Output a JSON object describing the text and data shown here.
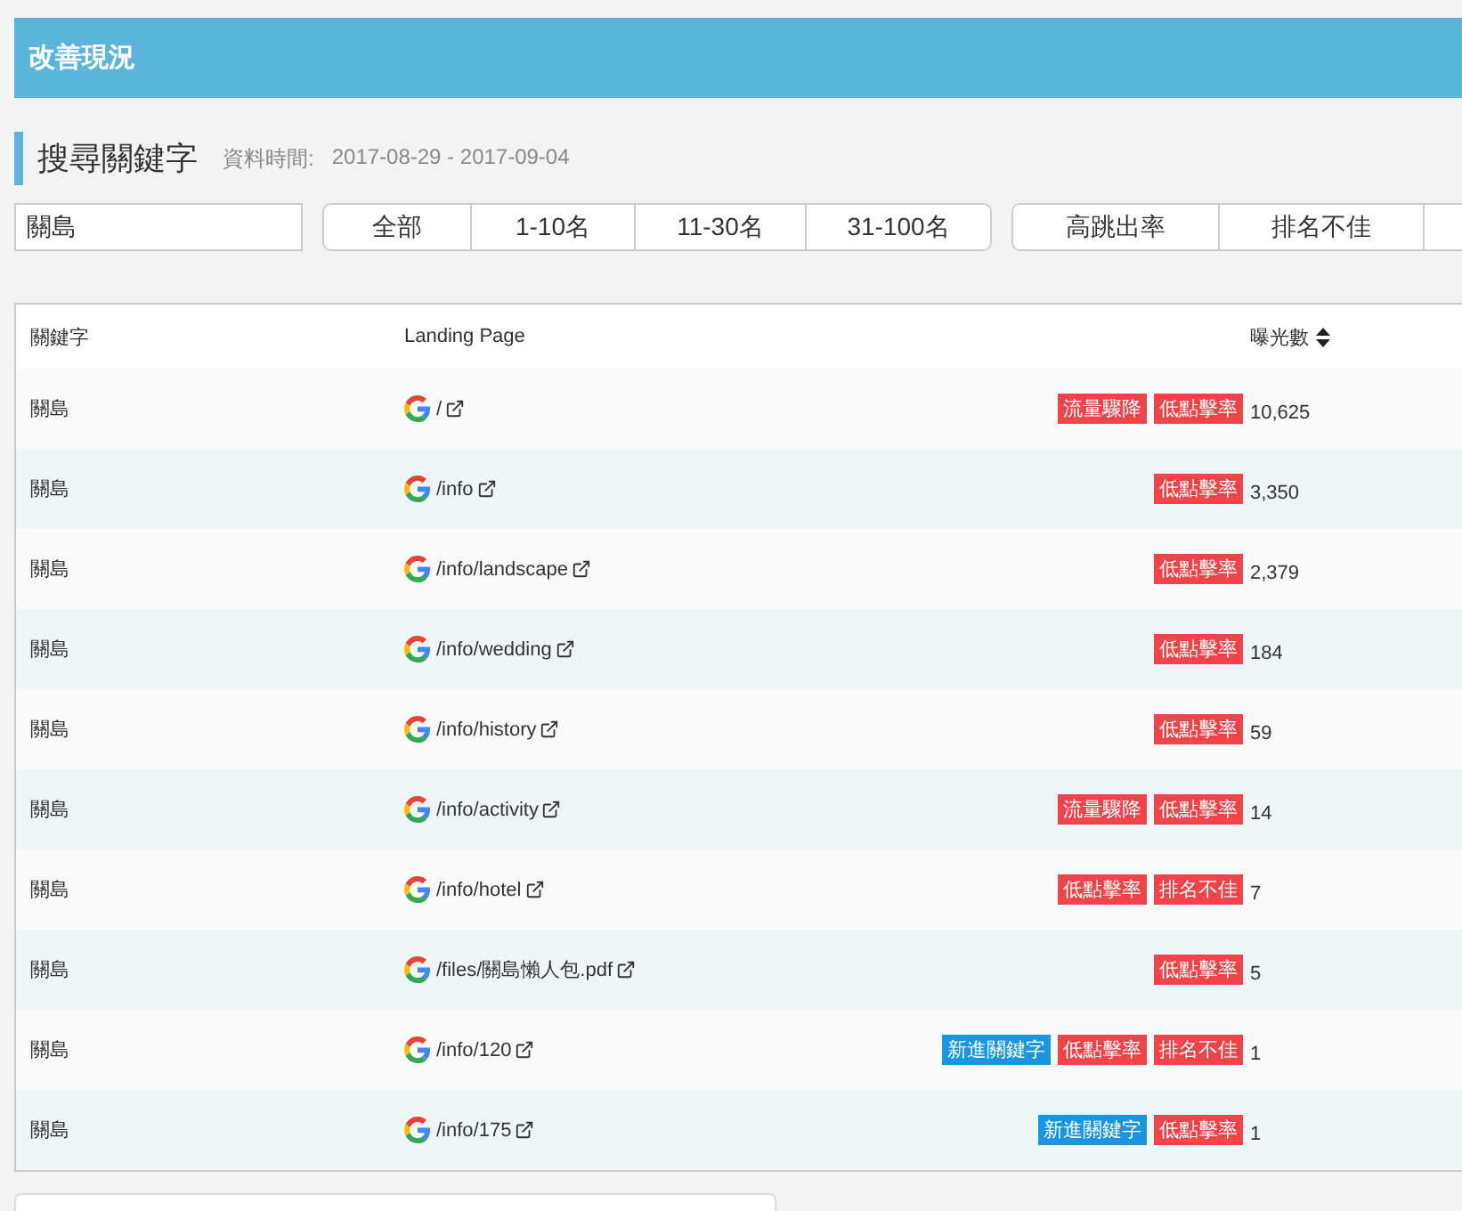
{
  "header": {
    "title": "改善現況"
  },
  "section": {
    "title": "搜尋關鍵字",
    "date_label": "資料時間:",
    "date_range": "2017-08-29 - 2017-09-04"
  },
  "search": {
    "value": "關島"
  },
  "rank_filters": [
    {
      "label": "全部",
      "selected": false
    },
    {
      "label": "1-10名",
      "selected": false
    },
    {
      "label": "11-30名",
      "selected": false
    },
    {
      "label": "31-100名",
      "selected": false
    }
  ],
  "issue_filters": [
    {
      "label": "高跳出率",
      "selected": false
    },
    {
      "label": "排名不佳",
      "selected": false
    }
  ],
  "table": {
    "columns": [
      "關鍵字",
      "Landing Page",
      "曝光數"
    ],
    "rows": [
      {
        "keyword": "關島",
        "page": "/",
        "tags": [
          {
            "label": "流量驟降",
            "color": "#f0434a"
          },
          {
            "label": "低點擊率",
            "color": "#f0434a"
          }
        ],
        "impressions": "10,625"
      },
      {
        "keyword": "關島",
        "page": "/info",
        "tags": [
          {
            "label": "低點擊率",
            "color": "#f0434a"
          }
        ],
        "impressions": "3,350"
      },
      {
        "keyword": "關島",
        "page": "/info/landscape",
        "tags": [
          {
            "label": "低點擊率",
            "color": "#f0434a"
          }
        ],
        "impressions": "2,379"
      },
      {
        "keyword": "關島",
        "page": "/info/wedding",
        "tags": [
          {
            "label": "低點擊率",
            "color": "#f0434a"
          }
        ],
        "impressions": "184"
      },
      {
        "keyword": "關島",
        "page": "/info/history",
        "tags": [
          {
            "label": "低點擊率",
            "color": "#f0434a"
          }
        ],
        "impressions": "59"
      },
      {
        "keyword": "關島",
        "page": "/info/activity",
        "tags": [
          {
            "label": "流量驟降",
            "color": "#f0434a"
          },
          {
            "label": "低點擊率",
            "color": "#f0434a"
          }
        ],
        "impressions": "14"
      },
      {
        "keyword": "關島",
        "page": "/info/hotel",
        "tags": [
          {
            "label": "低點擊率",
            "color": "#f0434a"
          },
          {
            "label": "排名不佳",
            "color": "#f0434a"
          }
        ],
        "impressions": "7"
      },
      {
        "keyword": "關島",
        "page": "/files/關島懶人包.pdf",
        "tags": [
          {
            "label": "低點擊率",
            "color": "#f0434a"
          }
        ],
        "impressions": "5"
      },
      {
        "keyword": "關島",
        "page": "/info/120",
        "tags": [
          {
            "label": "新進關鍵字",
            "color": "#1a96e0"
          },
          {
            "label": "低點擊率",
            "color": "#f0434a"
          },
          {
            "label": "排名不佳",
            "color": "#f0434a"
          }
        ],
        "impressions": "1"
      },
      {
        "keyword": "關島",
        "page": "/info/175",
        "tags": [
          {
            "label": "新進關鍵字",
            "color": "#1a96e0"
          },
          {
            "label": "低點擊率",
            "color": "#f0434a"
          }
        ],
        "impressions": "1"
      }
    ]
  }
}
